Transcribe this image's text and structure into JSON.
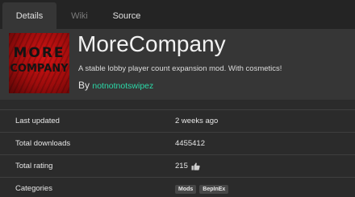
{
  "tabs": [
    {
      "label": "Details",
      "state": "active"
    },
    {
      "label": "Wiki",
      "state": "disabled"
    },
    {
      "label": "Source",
      "state": "normal"
    }
  ],
  "mod": {
    "image_text": [
      "MORE",
      "COMPANY"
    ],
    "title": "MoreCompany",
    "description": "A stable lobby player count expansion mod. With cosmetics!",
    "by_label": "By",
    "author": "notnotnotswipez"
  },
  "stats": {
    "last_updated": {
      "label": "Last updated",
      "value": "2 weeks ago"
    },
    "total_downloads": {
      "label": "Total downloads",
      "value": "4455412"
    },
    "total_rating": {
      "label": "Total rating",
      "value": "215",
      "icon": "thumbs-up-icon"
    },
    "categories": {
      "label": "Categories",
      "tags": [
        "Mods",
        "BepInEx"
      ]
    }
  },
  "colors": {
    "author_link": "#2bd9a8",
    "background": "#2b2b2b",
    "header_bg": "#363636",
    "image_red": "#d21414"
  }
}
